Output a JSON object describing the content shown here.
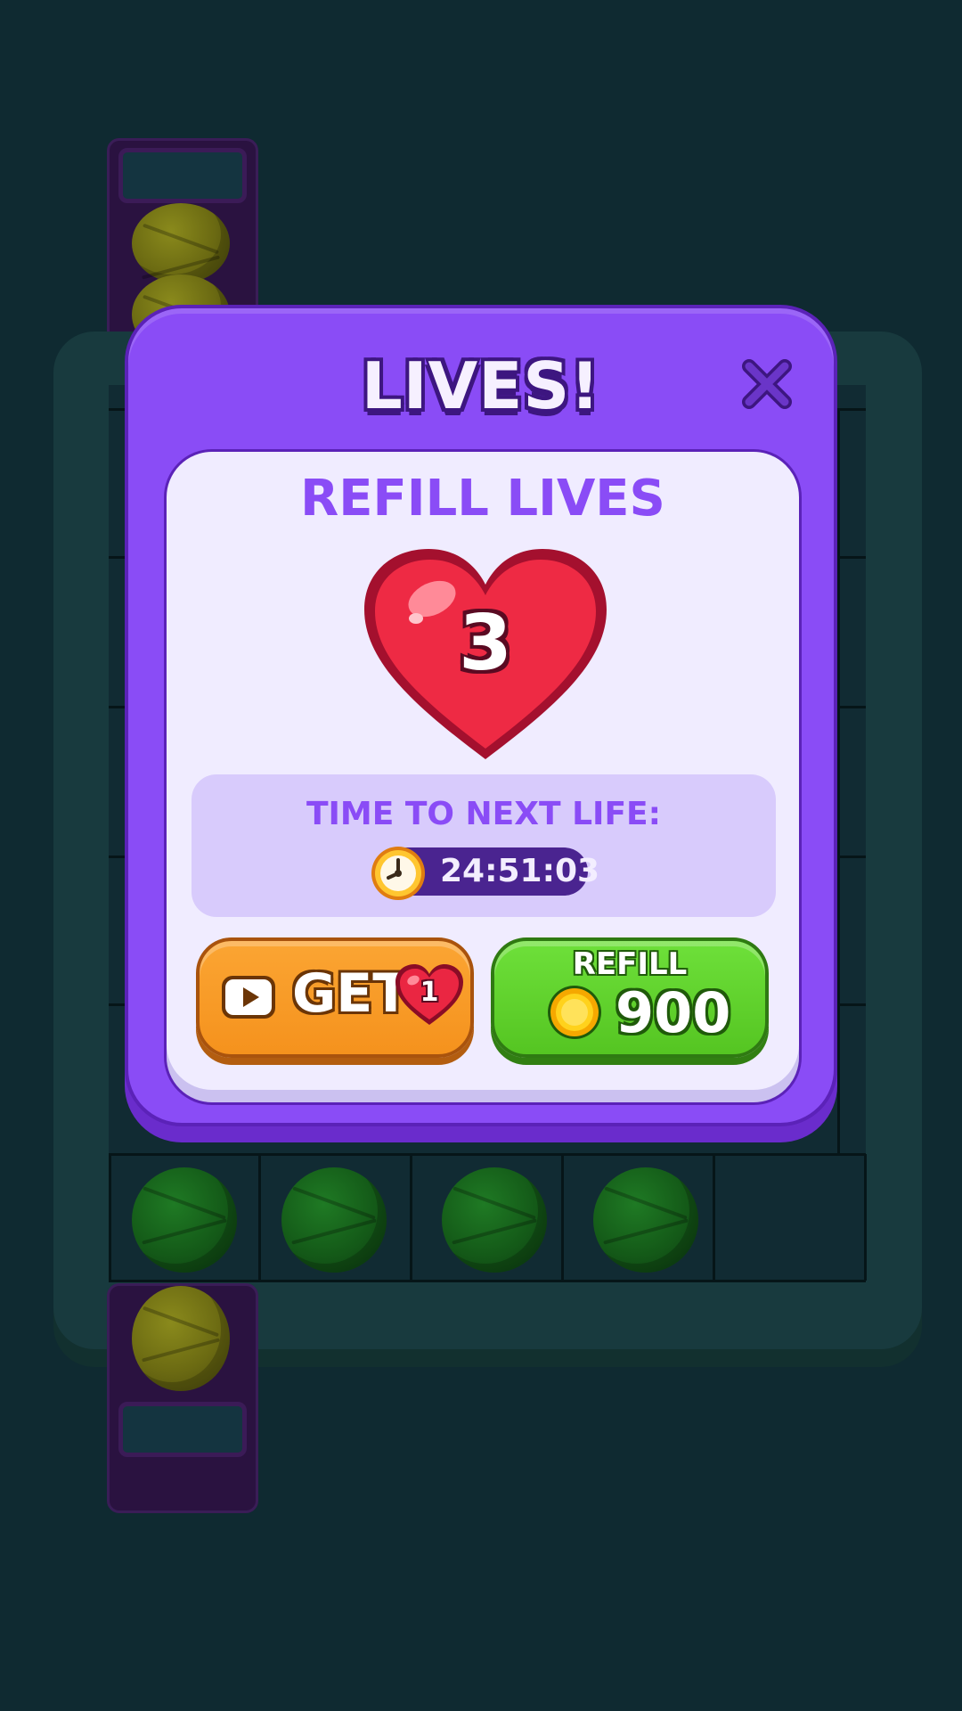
{
  "modal": {
    "title": "LIVES!",
    "close_icon": "close-icon",
    "card_title": "REFILL LIVES",
    "lives_count": "3",
    "timer": {
      "label": "TIME TO NEXT LIFE:",
      "value": "24:51:03",
      "icon": "stopwatch-icon"
    },
    "get_button": {
      "icon": "video-play-icon",
      "label": "GET",
      "heart_count": "1"
    },
    "refill_button": {
      "label": "REFILL",
      "icon": "coin-icon",
      "price": "900"
    }
  },
  "colors": {
    "modal_purple": "#8a4cf6",
    "card_bg": "#f0ecff",
    "get_orange": "#f5921d",
    "refill_green": "#55c522",
    "heart_red": "#e8223f"
  }
}
